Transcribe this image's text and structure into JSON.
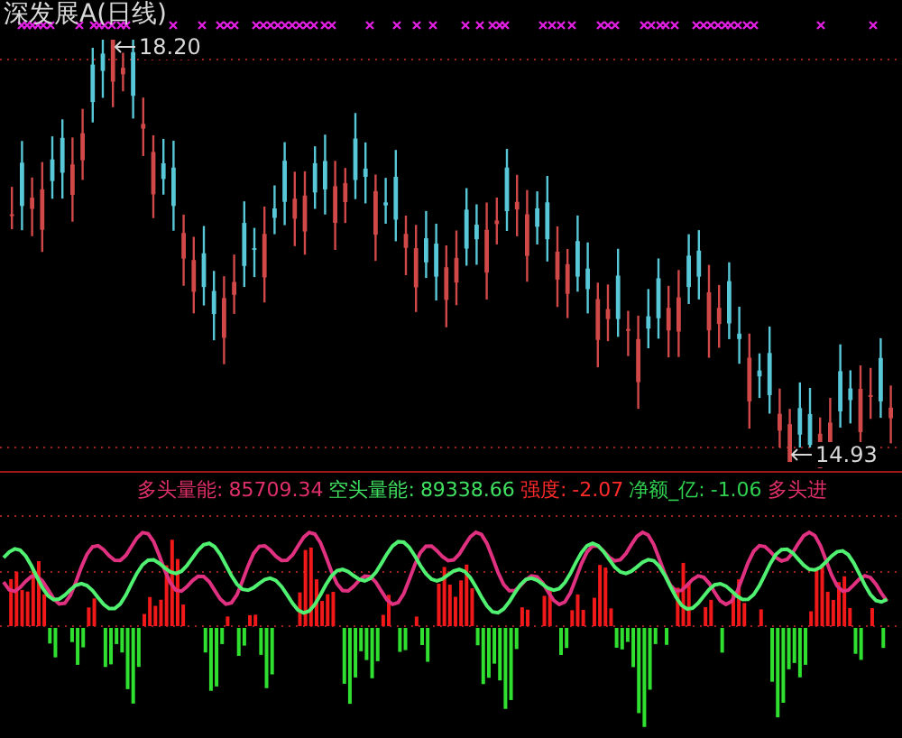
{
  "chart_title": "深发展A(日线)",
  "price_labels": [
    {
      "kind": "high",
      "text": "18.20"
    },
    {
      "kind": "low",
      "text": "14.93"
    }
  ],
  "indicator_readout": [
    {
      "label": "多头量能:",
      "value": "85709.34",
      "color": "#e0306a"
    },
    {
      "label": "空头量能:",
      "value": "89338.66",
      "color": "#40e060"
    },
    {
      "label": "强度:",
      "value": "-2.07",
      "color": "#ff2a2a"
    },
    {
      "label": "净额_亿:",
      "value": "-1.06",
      "color": "#30d050"
    },
    {
      "label": "多头进",
      "color": "#e0306a"
    }
  ]
}
